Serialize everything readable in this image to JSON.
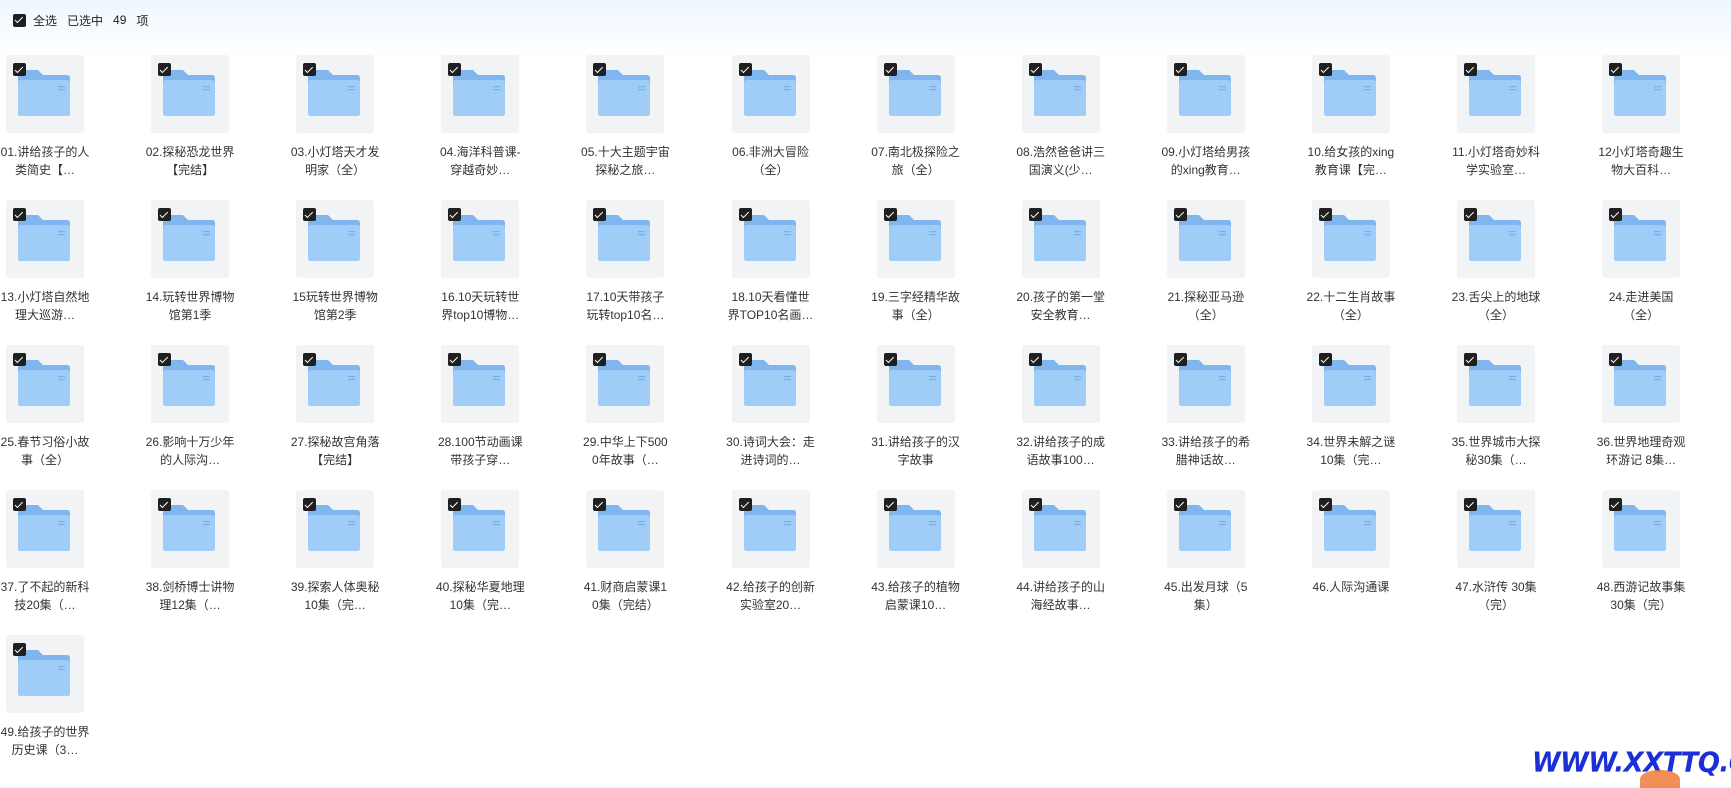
{
  "toolbar": {
    "select_all_label": "全选",
    "selected_label": "已选中",
    "selected_count": "49",
    "unit_label": "项"
  },
  "colors": {
    "folder_back": "#7fb6ef",
    "folder_front": "#9fcdf8",
    "checkbox": "#1f1f1f",
    "watermark": "#1a2fd6"
  },
  "items": [
    {
      "name": "01.讲给孩子的人类简史【…"
    },
    {
      "name": "02.探秘恐龙世界【完结】"
    },
    {
      "name": "03.小灯塔天才发明家（全）"
    },
    {
      "name": "04.海洋科普课-穿越奇妙…"
    },
    {
      "name": "05.十大主题宇宙探秘之旅…"
    },
    {
      "name": "06.非洲大冒险（全）"
    },
    {
      "name": "07.南北极探险之旅（全）"
    },
    {
      "name": "08.浩然爸爸讲三国演义(少…"
    },
    {
      "name": "09.小灯塔给男孩的xing教育…"
    },
    {
      "name": "10.给女孩的xing教育课【完…"
    },
    {
      "name": "11.小灯塔奇妙科学实验室…"
    },
    {
      "name": "12小灯塔奇趣生物大百科…"
    },
    {
      "name": "13.小灯塔自然地理大巡游…"
    },
    {
      "name": "14.玩转世界博物馆第1季"
    },
    {
      "name": "15玩转世界博物馆第2季"
    },
    {
      "name": "16.10天玩转世界top10博物…"
    },
    {
      "name": "17.10天带孩子玩转top10名…"
    },
    {
      "name": "18.10天看懂世界TOP10名画…"
    },
    {
      "name": "19.三字经精华故事（全）"
    },
    {
      "name": "20.孩子的第一堂安全教育…"
    },
    {
      "name": "21.探秘亚马逊（全）"
    },
    {
      "name": "22.十二生肖故事（全）"
    },
    {
      "name": "23.舌尖上的地球（全）"
    },
    {
      "name": "24.走进美国（全）"
    },
    {
      "name": "25.春节习俗小故事（全）"
    },
    {
      "name": "26.影响十万少年的人际沟…"
    },
    {
      "name": "27.探秘故宫角落【完结】"
    },
    {
      "name": "28.100节动画课带孩子穿…"
    },
    {
      "name": "29.中华上下5000年故事（…"
    },
    {
      "name": "30.诗词大会：走进诗词的…"
    },
    {
      "name": "31.讲给孩子的汉字故事"
    },
    {
      "name": "32.讲给孩子的成语故事100…"
    },
    {
      "name": "33.讲给孩子的希腊神话故…"
    },
    {
      "name": "34.世界未解之谜10集（完…"
    },
    {
      "name": "35.世界城市大探秘30集（…"
    },
    {
      "name": "36.世界地理奇观环游记 8集…"
    },
    {
      "name": "37.了不起的新科技20集（…"
    },
    {
      "name": "38.剑桥博士讲物理12集（…"
    },
    {
      "name": "39.探索人体奥秘10集（完…"
    },
    {
      "name": "40.探秘华夏地理10集（完…"
    },
    {
      "name": "41.财商启蒙课10集（完结）"
    },
    {
      "name": "42.给孩子的创新实验室20…"
    },
    {
      "name": "43.给孩子的植物启蒙课10…"
    },
    {
      "name": "44.讲给孩子的山海经故事…"
    },
    {
      "name": "45.出发月球（5集）"
    },
    {
      "name": "46.人际沟通课"
    },
    {
      "name": "47.水浒传 30集（完）"
    },
    {
      "name": "48.西游记故事集 30集（完）"
    },
    {
      "name": "49.给孩子的世界历史课（3…"
    }
  ],
  "watermark": {
    "text": "WWW.XXTTQ.COM"
  }
}
